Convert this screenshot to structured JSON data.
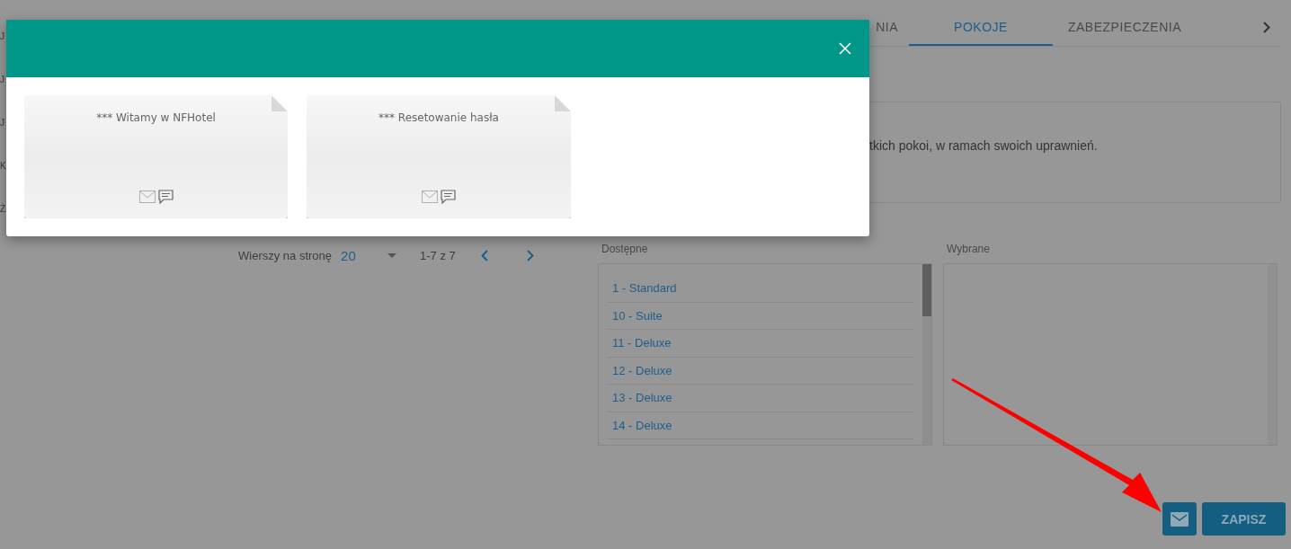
{
  "side_list": [
    "J",
    "J",
    "J",
    "K",
    "Ż"
  ],
  "tabs": [
    {
      "label": "NIA",
      "selected": false
    },
    {
      "label": "POKOJE",
      "selected": true
    },
    {
      "label": "ZABEZPIECZENIA",
      "selected": false
    }
  ],
  "info_text": "tkich pokoi, w ramach swoich uprawnień.",
  "pagination": {
    "rows_label": "Wierszy na stronę",
    "rows_value": "20",
    "range": "1-7 z 7"
  },
  "available": {
    "label": "Dostępne",
    "items": [
      "1 - Standard",
      "10 - Suite",
      "11 - Deluxe",
      "12 - Deluxe",
      "13 - Deluxe",
      "14 - Deluxe"
    ]
  },
  "selected_list": {
    "label": "Wybrane"
  },
  "save_button": "ZAPISZ",
  "modal": {
    "templates": [
      {
        "title": "*** Witamy w NFHotel"
      },
      {
        "title": "*** Resetowanie hasła"
      }
    ]
  }
}
